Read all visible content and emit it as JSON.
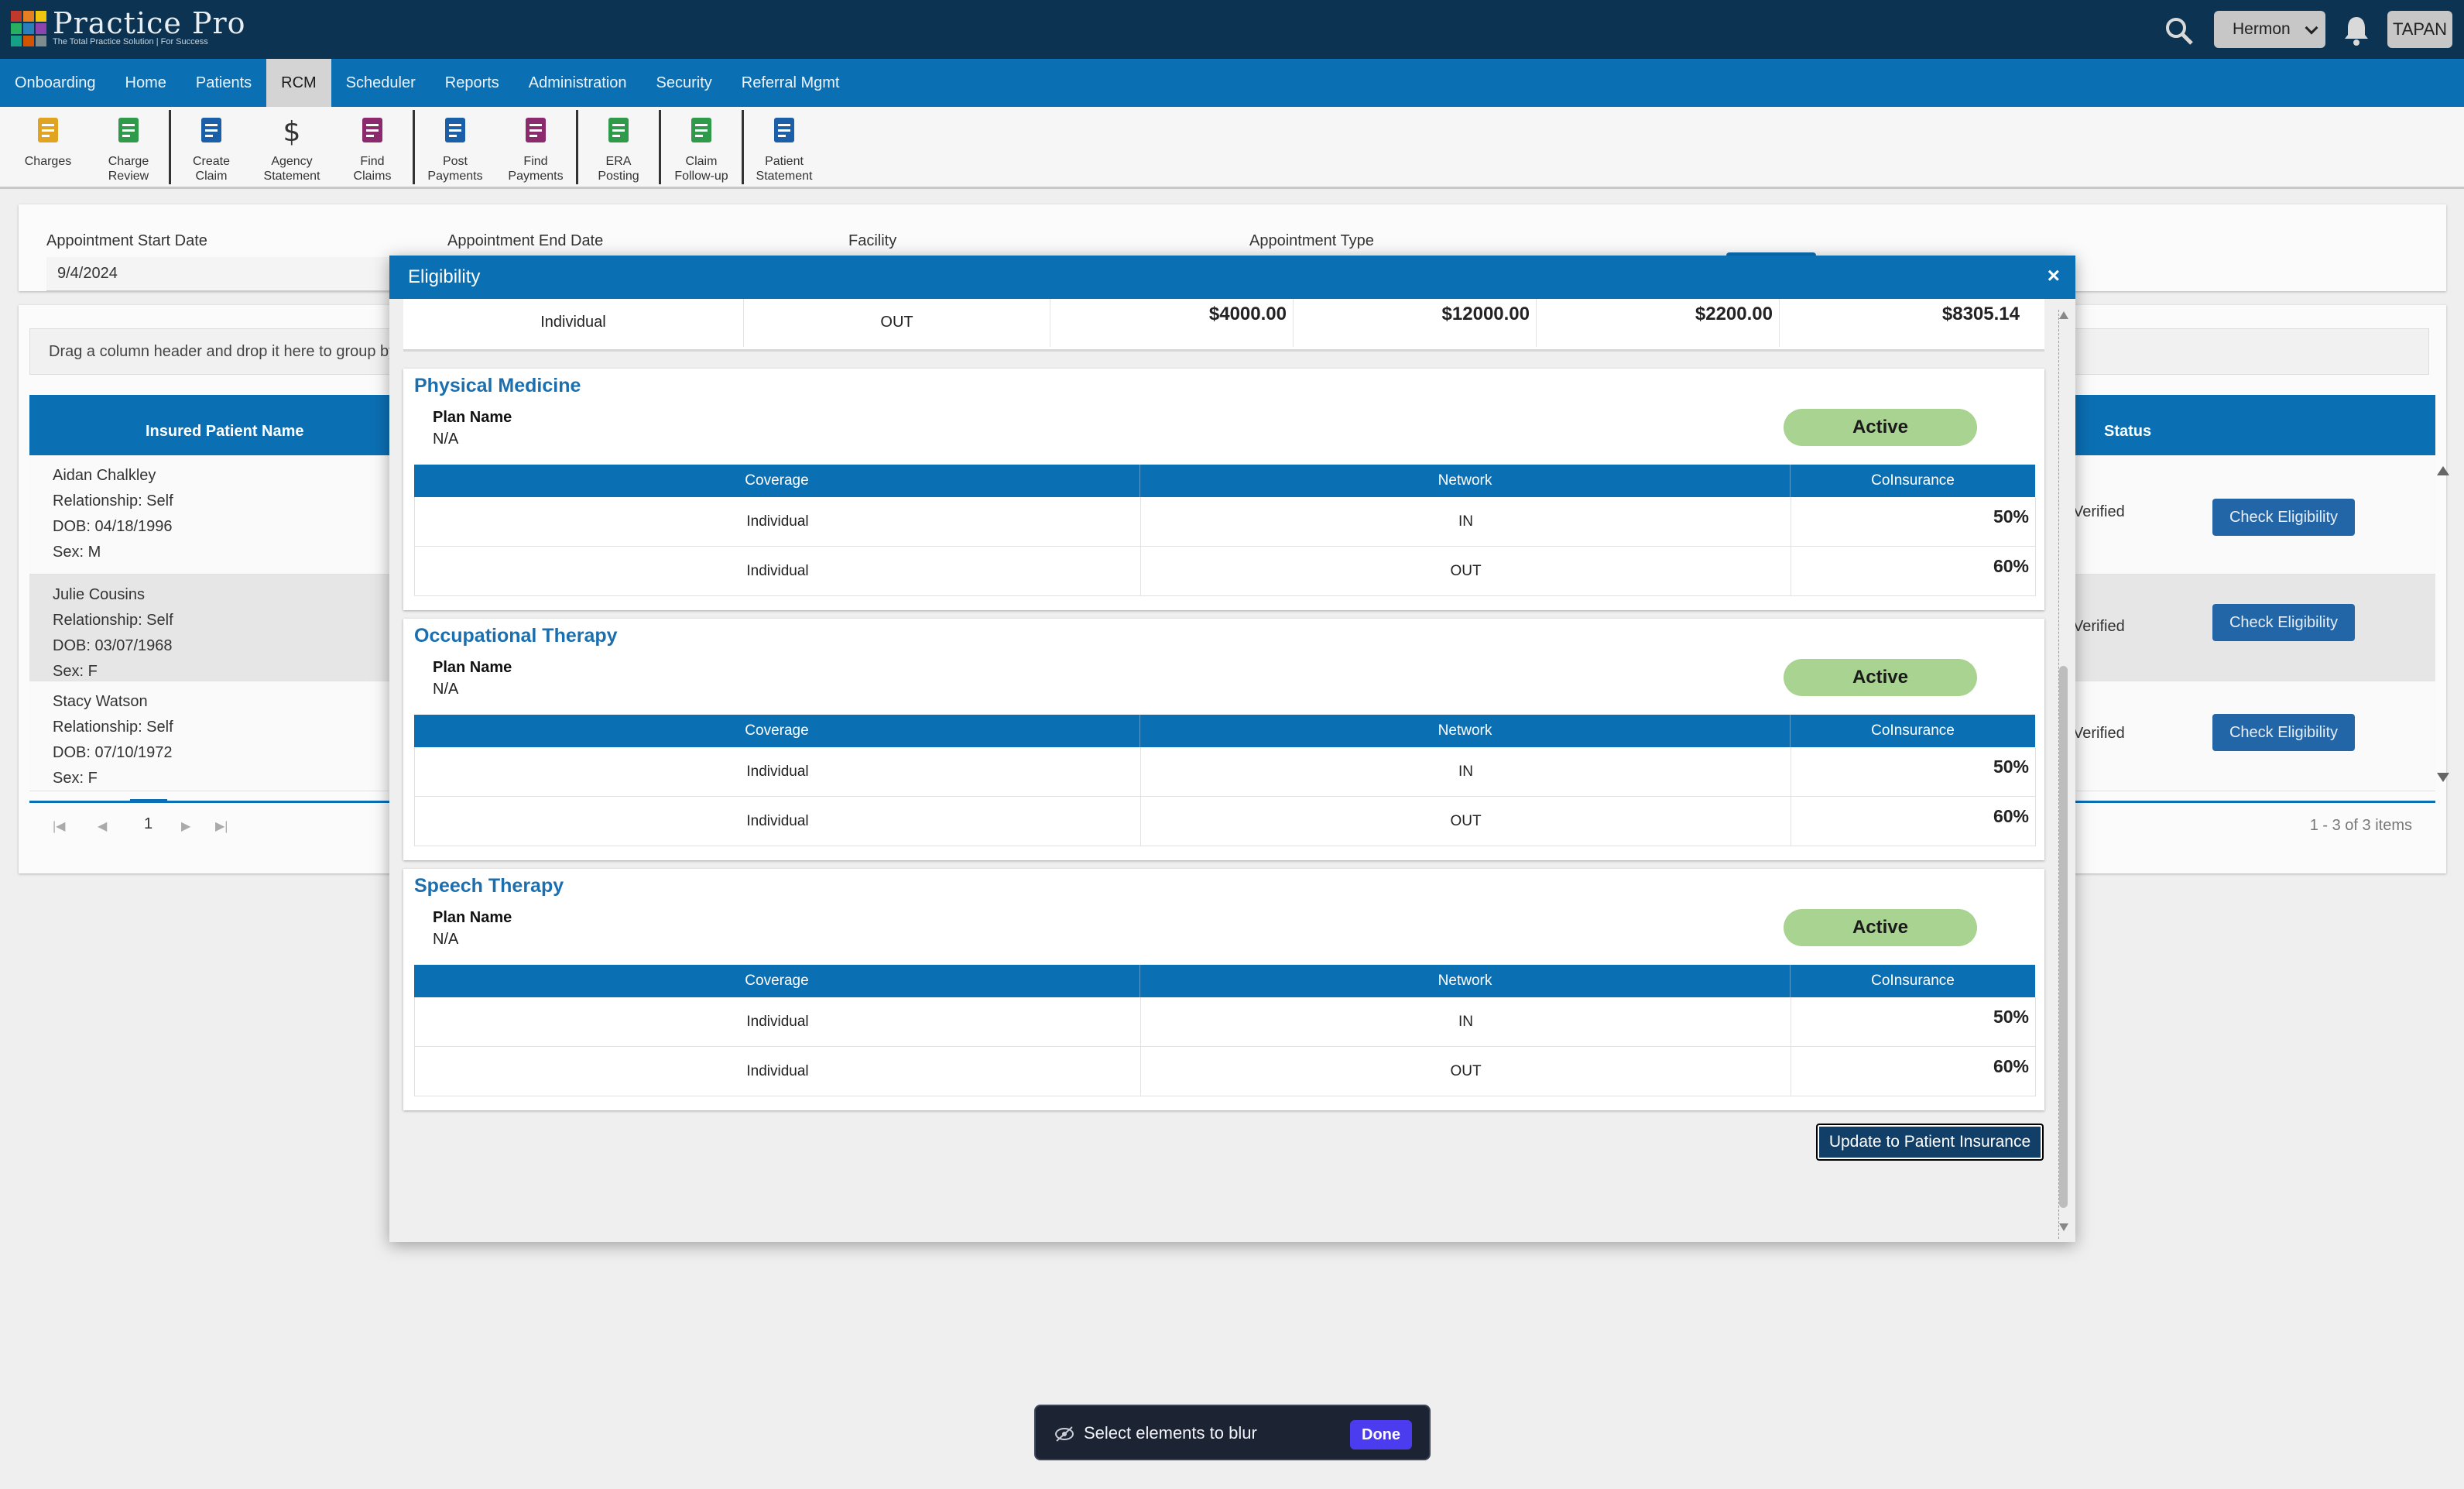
{
  "header": {
    "logo_title": "Practice Pro",
    "logo_tagline": "The Total Practice Solution | For Success",
    "facility": "Hermon",
    "user": "TAPAN"
  },
  "nav": {
    "items": [
      "Onboarding",
      "Home",
      "Patients",
      "RCM",
      "Scheduler",
      "Reports",
      "Administration",
      "Security",
      "Referral Mgmt"
    ],
    "active": "RCM"
  },
  "toolbar": {
    "tools": [
      {
        "line1": "Charges",
        "line2": ""
      },
      {
        "line1": "Charge",
        "line2": "Review"
      },
      {
        "line1": "Create",
        "line2": "Claim"
      },
      {
        "line1": "Agency",
        "line2": "Statement"
      },
      {
        "line1": "Find",
        "line2": "Claims"
      },
      {
        "line1": "Post",
        "line2": "Payments"
      },
      {
        "line1": "Find",
        "line2": "Payments"
      },
      {
        "line1": "ERA",
        "line2": "Posting"
      },
      {
        "line1": "Claim",
        "line2": "Follow-up"
      },
      {
        "line1": "Patient",
        "line2": "Statement"
      }
    ]
  },
  "filters": {
    "start_label": "Appointment Start Date",
    "start_value": "9/4/2024",
    "end_label": "Appointment End Date",
    "facility_label": "Facility",
    "type_label": "Appointment Type"
  },
  "grid": {
    "group_hint": "Drag a column header and drop it here to group by t",
    "col_name": "Insured Patient Name",
    "col_status": "Status",
    "rows": [
      {
        "name": "Aidan Chalkley",
        "rel": "Relationship: Self",
        "dob": "DOB: 04/18/1996",
        "sex": "Sex: M",
        "status": "Verified",
        "action": "Check Eligibility"
      },
      {
        "name": "Julie Cousins",
        "rel": "Relationship: Self",
        "dob": "DOB: 03/07/1968",
        "sex": "Sex: F",
        "status": "Verified",
        "action": "Check Eligibility"
      },
      {
        "name": "Stacy Watson",
        "rel": "Relationship: Self",
        "dob": "DOB: 07/10/1972",
        "sex": "Sex: F",
        "status": "Verified",
        "action": "Check Eligibility"
      }
    ],
    "page": "1",
    "items_text": "1 - 3 of 3 items"
  },
  "modal": {
    "title": "Eligibility",
    "close": "×",
    "prev_row": {
      "coverage": "Individual",
      "network": "OUT",
      "amounts": [
        "$4000.00",
        "$12000.00",
        "$2200.00",
        "$8305.14"
      ]
    },
    "columns": {
      "coverage": "Coverage",
      "network": "Network",
      "coinsurance": "CoInsurance"
    },
    "sections": [
      {
        "title": "Physical Medicine",
        "plan_label": "Plan Name",
        "plan_value": "N/A",
        "status": "Active",
        "rows": [
          {
            "coverage": "Individual",
            "network": "IN",
            "coinsurance": "50%"
          },
          {
            "coverage": "Individual",
            "network": "OUT",
            "coinsurance": "60%"
          }
        ]
      },
      {
        "title": "Occupational Therapy",
        "plan_label": "Plan Name",
        "plan_value": "N/A",
        "status": "Active",
        "rows": [
          {
            "coverage": "Individual",
            "network": "IN",
            "coinsurance": "50%"
          },
          {
            "coverage": "Individual",
            "network": "OUT",
            "coinsurance": "60%"
          }
        ]
      },
      {
        "title": "Speech Therapy",
        "plan_label": "Plan Name",
        "plan_value": "N/A",
        "status": "Active",
        "rows": [
          {
            "coverage": "Individual",
            "network": "IN",
            "coinsurance": "50%"
          },
          {
            "coverage": "Individual",
            "network": "OUT",
            "coinsurance": "60%"
          }
        ]
      }
    ],
    "update_button": "Update to Patient Insurance"
  },
  "blurbar": {
    "text": "Select elements to blur",
    "done": "Done"
  },
  "colors": {
    "header": "#0c3452",
    "nav": "#0b6fb3",
    "active_pill": "#a8d391",
    "done": "#4b3cf0"
  }
}
